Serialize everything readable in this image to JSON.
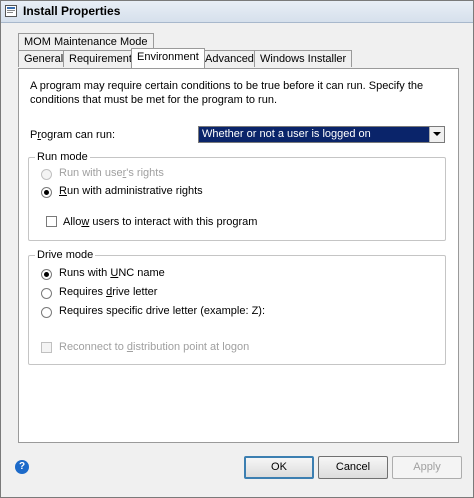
{
  "window": {
    "title": "Install Properties"
  },
  "tabs": {
    "row1": [
      {
        "label": "MOM Maintenance Mode"
      }
    ],
    "row2": [
      {
        "label": "General"
      },
      {
        "label": "Requirements"
      },
      {
        "label": "Environment"
      },
      {
        "label": "Advanced"
      },
      {
        "label": "Windows Installer"
      }
    ],
    "active": "Environment"
  },
  "environment": {
    "description": "A program may require certain conditions to be true before it can run. Specify the conditions that must be met for the program to run.",
    "program_can_run": {
      "label_pre": "P",
      "label_u": "r",
      "label_post": "ogram can run:",
      "selected": "Whether or not a user is logged on"
    },
    "run_mode": {
      "title": "Run mode",
      "user_rights": {
        "pre": "Run with use",
        "u": "r",
        "post": "'s rights",
        "checked": false,
        "disabled": true
      },
      "admin_rights": {
        "pre": "",
        "u": "R",
        "post": "un with administrative rights",
        "checked": true,
        "disabled": false
      },
      "allow_interact": {
        "pre": "Allo",
        "u": "w",
        "post": " users to interact with this program",
        "checked": false,
        "disabled": false
      }
    },
    "drive_mode": {
      "title": "Drive mode",
      "unc": {
        "pre": "Runs with ",
        "u": "U",
        "post": "NC name",
        "checked": true
      },
      "drive_letter": {
        "pre": "Requires ",
        "u": "d",
        "post": "rive letter",
        "checked": false
      },
      "specific_letter": {
        "pre": "Requires specific drive letter (example: Z):",
        "u": "",
        "post": "",
        "checked": false
      },
      "reconnect": {
        "pre": "Reconnect to ",
        "u": "d",
        "post": "istribution point at logon",
        "checked": false,
        "disabled": true
      }
    }
  },
  "buttons": {
    "ok": "OK",
    "cancel": "Cancel",
    "apply": "Apply"
  },
  "help": {
    "glyph": "?"
  }
}
